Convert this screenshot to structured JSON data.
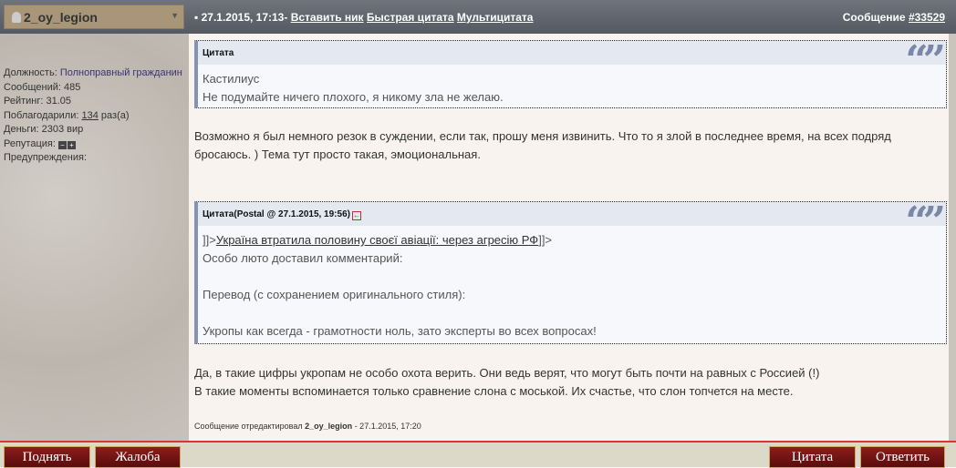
{
  "header": {
    "username": "2_oy_legion",
    "date": "27.1.2015, 17:13-",
    "links": [
      "Вставить ник",
      "Быстрая цитата",
      "Мультицитата"
    ],
    "message_label": "Сообщение",
    "message_number": "#33529"
  },
  "profile": {
    "position_label": "Должность:",
    "position": "Полноправный гражданин",
    "posts": "Сообщений: 485",
    "rating": "Рейтинг: 31.05",
    "thanked_label": "Поблагодарили:",
    "thanked_count": "134",
    "thanked_suffix": "раз(а)",
    "money": "Деньги: 2303 вир",
    "reputation_label": "Репутация:",
    "warnings": "Предупреждения:"
  },
  "post": {
    "quote1": {
      "title": "Цитата",
      "lines": [
        "Кастилиус",
        "Не подумайте ничего плохого, я никому зла не желаю."
      ]
    },
    "para1": [
      "Возможно я был немного резок в суждении, если так, прошу меня извинить. Что то я злой в последнее время, на всех подряд",
      "бросаюсь. ) Тема тут просто такая, эмоциональная."
    ],
    "quote2": {
      "title": "Цитата(Postal @ 27.1.2015, 19:56)",
      "prefix": "]]>",
      "link": "Україна втратила половину своєї авіації: через агресію РФ",
      "suffix": "]]>",
      "lines": [
        "Особо люто доставил комментарий:",
        "Перевод (с сохранением оригинального стиля):",
        "Укропы как всегда - грамотности ноль, зато эксперты во всех вопросах!"
      ]
    },
    "para2": [
      "Да, в такие цифры укропам не особо охота верить. Они ведь верят, что могут быть почти на равных с Россией (!)",
      "В такие моменты вспоминается только сравнение слона с моськой. Их счастье, что слон топчется на месте."
    ],
    "edit_prefix": "Сообщение отредактировал",
    "edit_user": "2_oy_legion",
    "edit_date": "- 27.1.2015, 17:20"
  },
  "buttons": {
    "up": "Поднять",
    "report": "Жалоба",
    "quote": "Цитата",
    "reply": "Ответить"
  }
}
